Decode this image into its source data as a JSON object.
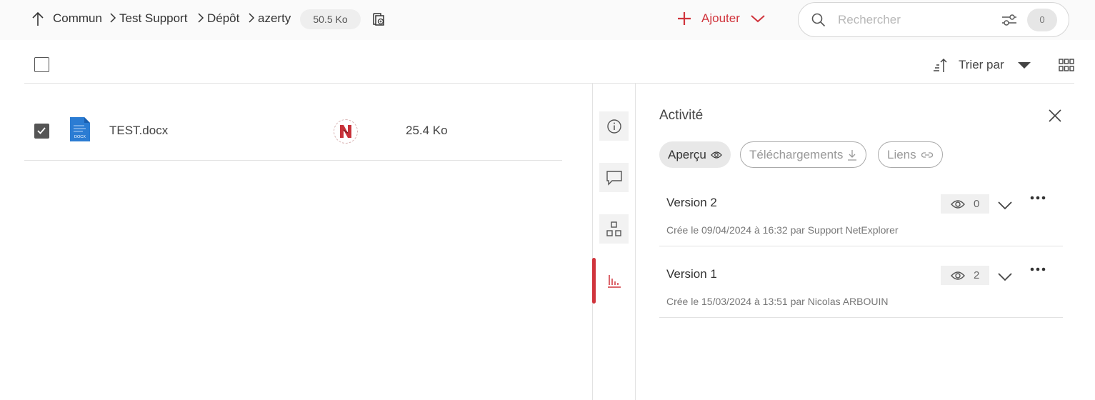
{
  "breadcrumb": {
    "items": [
      "Commun",
      "Test Support",
      "Dépôt",
      "azerty"
    ],
    "folder_size": "50.5 Ko"
  },
  "toolbar": {
    "add_label": "Ajouter",
    "search_placeholder": "Rechercher",
    "filter_count": "0",
    "sort_label": "Trier par"
  },
  "files": [
    {
      "name": "TEST.docx",
      "size": "25.4 Ko",
      "type_label": "DOCX",
      "selected": true
    }
  ],
  "activity": {
    "title": "Activité",
    "tabs": [
      {
        "label": "Aperçu",
        "active": true
      },
      {
        "label": "Téléchargements",
        "active": false
      },
      {
        "label": "Liens",
        "active": false
      }
    ],
    "versions": [
      {
        "title": "Version 2",
        "views": "0",
        "meta": "Crée le 09/04/2024 à 16:32 par Support NetExplorer"
      },
      {
        "title": "Version 1",
        "views": "2",
        "meta": "Crée le 15/03/2024 à 13:51 par Nicolas ARBOUIN"
      }
    ]
  },
  "colors": {
    "accent": "#d0343c",
    "docx_blue": "#2b7cd3"
  },
  "icons": [
    "arrow-up-icon",
    "chevron-right-icon",
    "copy-icon",
    "plus-icon",
    "chevron-down-icon",
    "search-icon",
    "filter-icon",
    "sort-icon",
    "caret-down-icon",
    "grid-view-icon",
    "docx-file-icon",
    "info-icon",
    "comment-icon",
    "apps-icon",
    "activity-chart-icon",
    "close-icon",
    "eye-icon",
    "download-icon",
    "link-icon",
    "more-icon"
  ]
}
